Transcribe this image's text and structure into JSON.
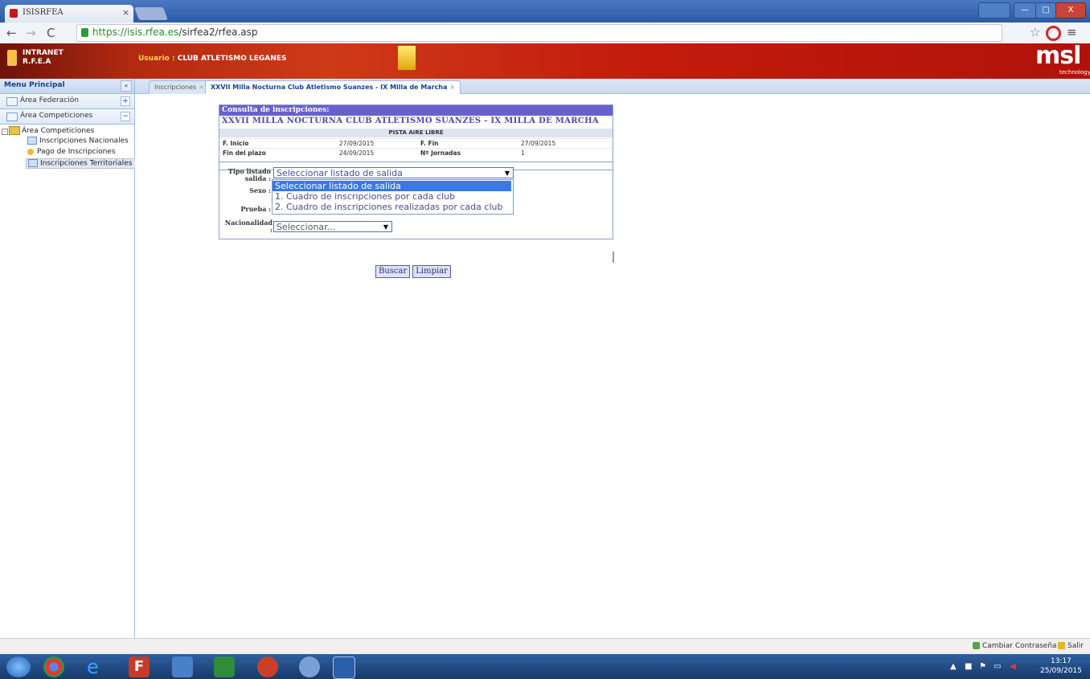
{
  "browser": {
    "tab_title": "ISISRFEA",
    "tab_close": "×",
    "url_host": "https://isis.rfea.es",
    "url_path": "/sirfea2/rfea.asp",
    "window_btn_min": "—",
    "window_btn_max": "□",
    "window_btn_close": "X"
  },
  "header": {
    "brand_line1": "INTRANET",
    "brand_line2": "R.F.E.A",
    "user_label": "Usuario : ",
    "user_value": "CLUB ATLETISMO LEGANES",
    "logo_text": "msl",
    "logo_sub": "technology"
  },
  "sidebar": {
    "title": "Menu Principal",
    "collapse": "«",
    "sections": [
      {
        "label": "Área Federación",
        "toggle": "+"
      },
      {
        "label": "Área Competiciones",
        "toggle": "−"
      }
    ],
    "tree_root": "Área Competiciones",
    "items": [
      "Inscripciones Nacionales",
      "Pago de Inscripciones",
      "Inscripciones Territoriales"
    ]
  },
  "tabs": [
    {
      "label": "Inscripciones"
    },
    {
      "label": "XXVII Milla Nocturna Club Atletismo Suanzes - IX Milla de Marcha"
    }
  ],
  "tab_close": "×",
  "consulta": {
    "header": "Consulta de inscripciones:",
    "event_title": "XXVII MILLA NOCTURNA CLUB ATLETISMO SUANZES - IX MILLA DE MARCHA",
    "venue": "PISTA AIRE LIBRE",
    "f_inicio_label": "F. Inicio",
    "f_inicio_value": "27/09/2015",
    "f_fin_label": "F. Fin",
    "f_fin_value": "27/09/2015",
    "fin_plazo_label": "Fin del plazo",
    "fin_plazo_value": "24/09/2015",
    "jornadas_label": "Nº Jornadas",
    "jornadas_value": "1"
  },
  "form": {
    "tipo_label": "Tipo listado salida :",
    "tipo_value": "Seleccionar listado de salida",
    "sexo_label": "Sexo :",
    "prueba_label": "Prueba :",
    "nacionalidad_label": "Nacionalidad :",
    "nacionalidad_value": "Seleccionar...",
    "dropdown_options": [
      "Seleccionar listado de salida",
      "1. Cuadro de inscripciones por cada club",
      "2. Cuadro de inscripciones realizadas por cada club"
    ],
    "search_button": "Buscar",
    "clear_button": "Limpiar"
  },
  "statusbar": {
    "change_password": "Cambiar Contraseña",
    "logout": "Salir"
  },
  "taskbar": {
    "time": "13:17",
    "date": "25/09/2015"
  },
  "colors": {
    "header_red": "#c31a0d",
    "panel_header": "#6b5fd0",
    "selection_blue": "#3b78e7"
  }
}
